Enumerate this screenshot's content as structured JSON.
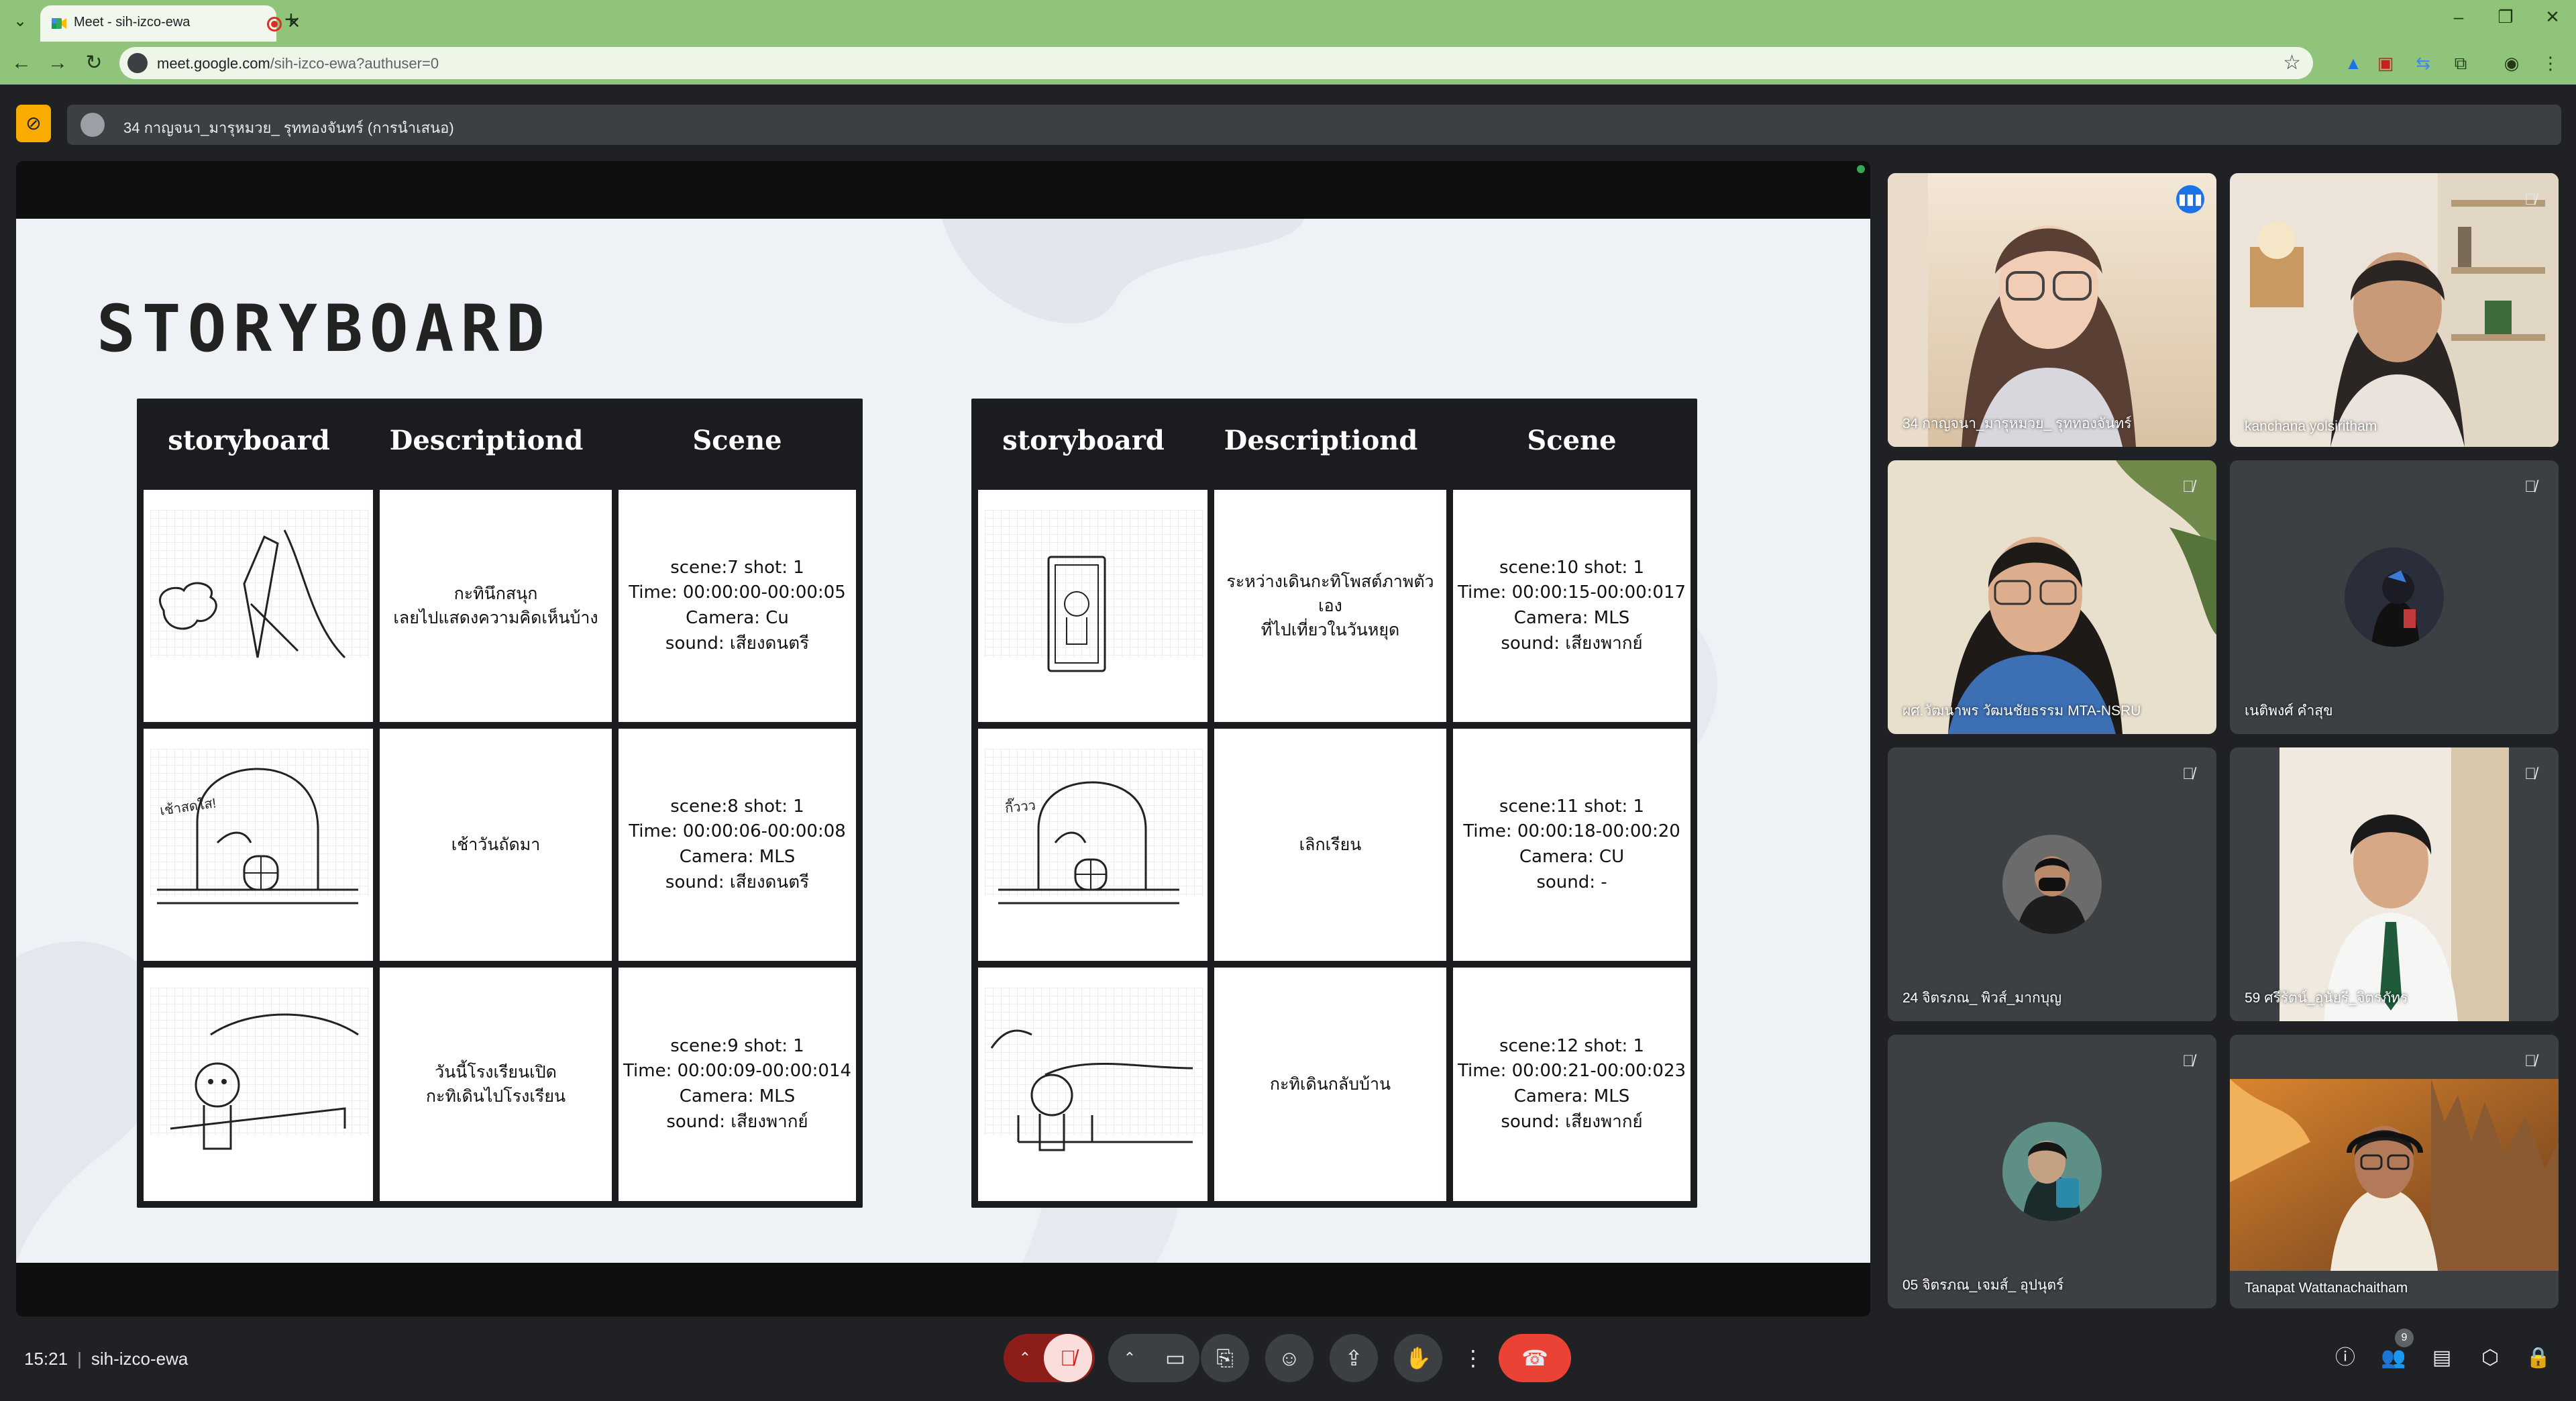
{
  "browser": {
    "tab_title": "Meet - sih-izco-ewa",
    "url_host": "meet.google.com",
    "url_path": "/sih-izco-ewa?authuser=0",
    "tab_close": "✕",
    "new_tab": "+",
    "window_minimize": "–",
    "window_restore": "❐",
    "window_close": "✕"
  },
  "meet": {
    "presenting_label": "34 กาญจนา_มารุหมวย_ รุททองจันทร์ (การนำเสนอ)",
    "slide": {
      "title": "STORYBOARD",
      "left_table": {
        "headers": [
          "storyboard",
          "Descriptiond",
          "Scene"
        ],
        "rows": [
          {
            "description": "กะทินึกสนุก\nเลยไปแสดงความคิดเห็นบ้าง",
            "scene": "scene:7 shot: 1\nTime: 00:00:00-00:00:05\nCamera: Cu\nsound: เสียงดนตรี"
          },
          {
            "description": "เช้าวันถัดมา",
            "scene": "scene:8 shot: 1\nTime: 00:00:06-00:00:08\nCamera: MLS\nsound: เสียงดนตรี",
            "sketch_label": "เช้าสดใส!"
          },
          {
            "description": "วันนี้โรงเรียนเปิด\nกะทิเดินไปโรงเรียน",
            "scene": "scene:9 shot: 1\nTime: 00:00:09-00:00:014\nCamera: MLS\nsound: เสียงพากย์"
          }
        ]
      },
      "right_table": {
        "headers": [
          "storyboard",
          "Descriptiond",
          "Scene"
        ],
        "rows": [
          {
            "description": "ระหว่างเดินกะทิโพสต์ภาพตัวเอง\nที่ไปเที่ยวในวันหยุด",
            "scene": "scene:10 shot: 1\nTime: 00:00:15-00:00:017\nCamera: MLS\nsound: เสียงพากย์"
          },
          {
            "description": "เลิกเรียน",
            "scene": "scene:11 shot: 1\nTime: 00:00:18-00:00:20\nCamera: CU\nsound: -",
            "sketch_label": "กี๊ววว"
          },
          {
            "description": "กะทิเดินกลับบ้าน",
            "scene": "scene:12 shot: 1\nTime: 00:00:21-00:00:023\nCamera: MLS\nsound: เสียงพากย์"
          }
        ]
      }
    },
    "participants": [
      {
        "name": "34 กาญจนา_มารุหมวย_ รุททองจันทร์",
        "state": "speaking"
      },
      {
        "name": "kanchana yolsiritham",
        "state": "muted"
      },
      {
        "name": "ผศ.วัฒนาพร วัฒนชัยธรรม MTA-NSRU",
        "state": "muted"
      },
      {
        "name": "เนติพงศ์ คำสุข",
        "state": "muted"
      },
      {
        "name": "24 จิตรภณ_ พิวส์_มากบุญ",
        "state": "muted"
      },
      {
        "name": "59 ศรีรัตน์_อุนัยรี_จิตรภัทร",
        "state": "muted"
      },
      {
        "name": "05 จิตรภณ_เจมส์_ อุปนุตร์",
        "state": "muted"
      },
      {
        "name": "Tanapat Wattanachaitham",
        "state": "muted"
      }
    ],
    "footer": {
      "time": "15:21",
      "meeting_code": "sih-izco-ewa",
      "participant_count": "9"
    }
  },
  "colors": {
    "chrome_green": "#8fc47a",
    "meet_bg": "#202124",
    "tile_bg": "#3c4043",
    "hangup_red": "#ea4335",
    "active_speaker_outline": "#8ab4f8",
    "record_badge": "#f9ab00"
  }
}
